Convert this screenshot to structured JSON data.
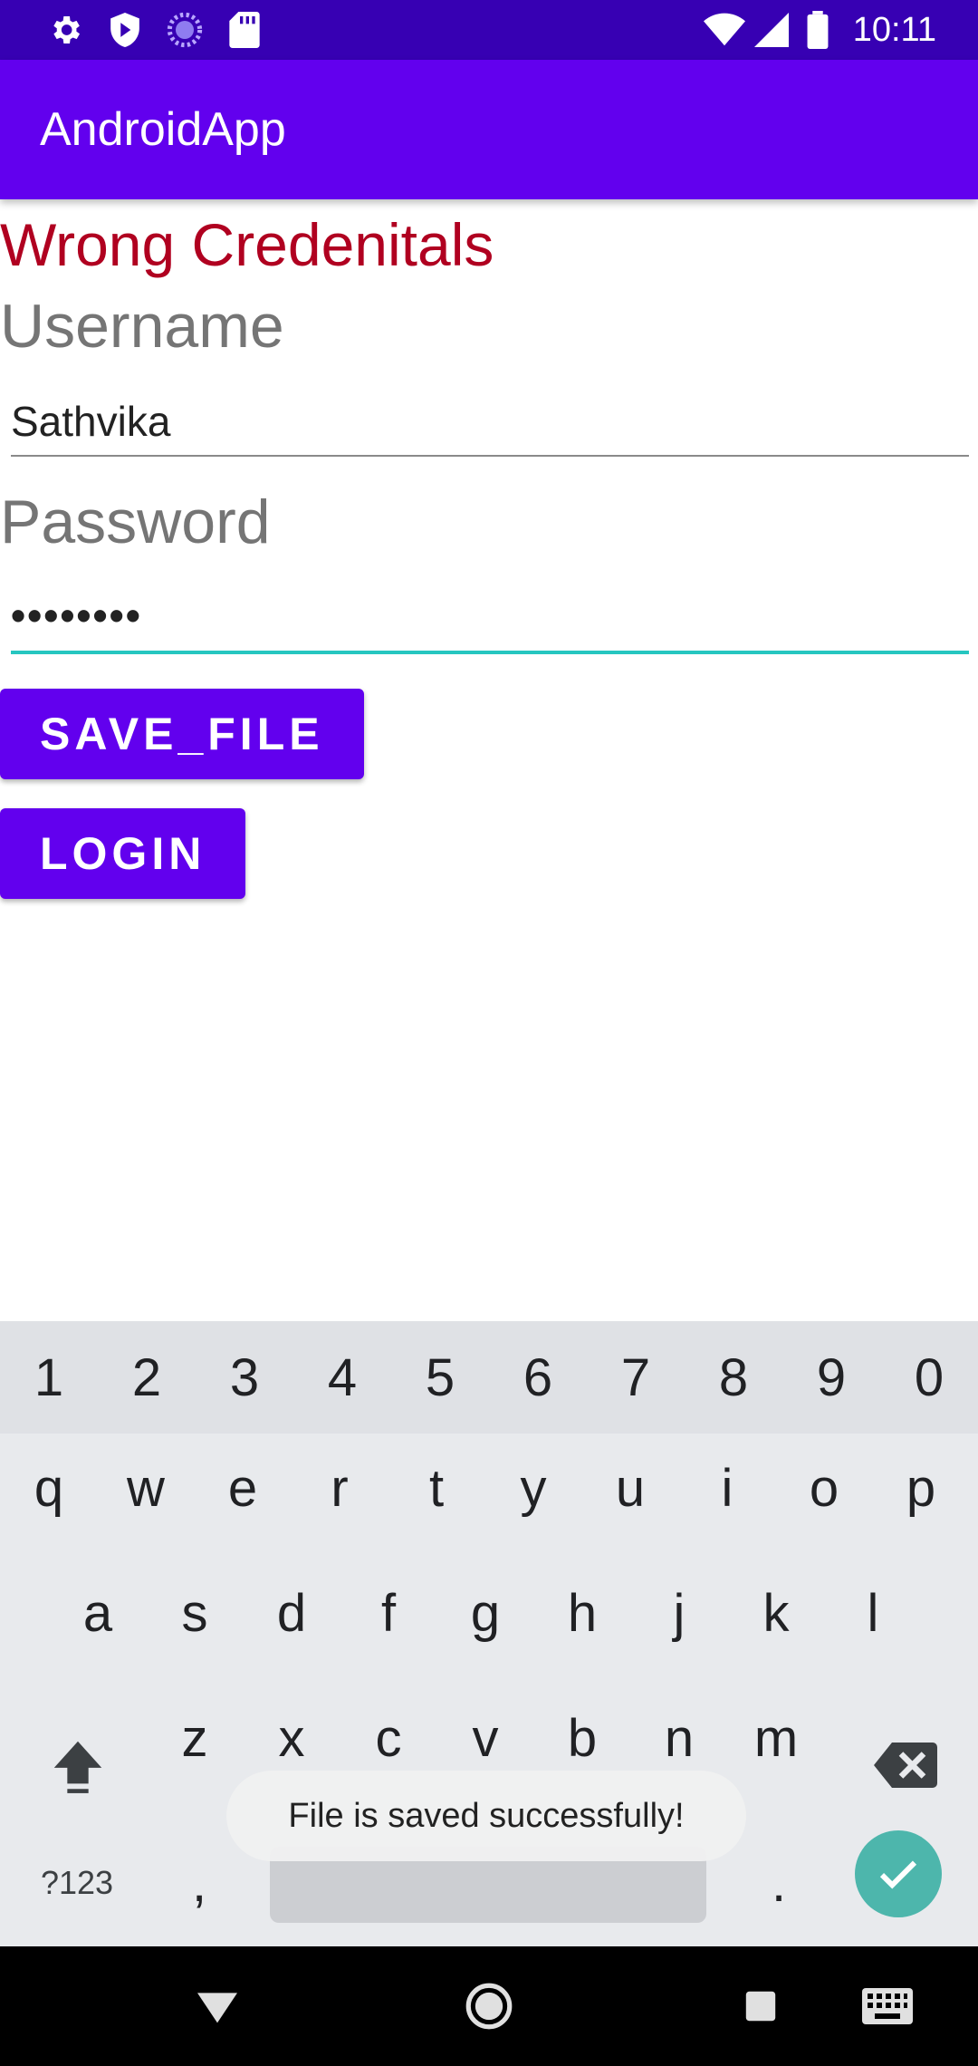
{
  "status_bar": {
    "time": "10:11",
    "left_icons": [
      "gear-icon",
      "shield-icon",
      "sync-icon",
      "sd-card-icon"
    ],
    "right_icons": [
      "wifi-icon",
      "signal-icon",
      "battery-icon"
    ]
  },
  "app_bar": {
    "title": "AndroidApp"
  },
  "form": {
    "error_message": "Wrong Credenitals",
    "username_label": "Username",
    "username_value": "Sathvika",
    "password_label": "Password",
    "password_value": "••••••••",
    "save_button": "SAVE_FILE",
    "login_button": "LOGIN"
  },
  "keyboard": {
    "numbers": [
      "1",
      "2",
      "3",
      "4",
      "5",
      "6",
      "7",
      "8",
      "9",
      "0"
    ],
    "row1": [
      "q",
      "w",
      "e",
      "r",
      "t",
      "y",
      "u",
      "i",
      "o",
      "p"
    ],
    "row2": [
      "a",
      "s",
      "d",
      "f",
      "g",
      "h",
      "j",
      "k",
      "l"
    ],
    "row3": [
      "z",
      "x",
      "c",
      "v",
      "b",
      "n",
      "m"
    ],
    "symbols_key": "?123",
    "comma_key": ",",
    "period_key": "."
  },
  "toast": {
    "message": "File is saved successfully!"
  },
  "colors": {
    "status_bar": "#3700b3",
    "app_bar": "#6200ee",
    "error": "#b00020",
    "focus_underline": "#26c6c0",
    "enter_key": "#4db6ac"
  }
}
